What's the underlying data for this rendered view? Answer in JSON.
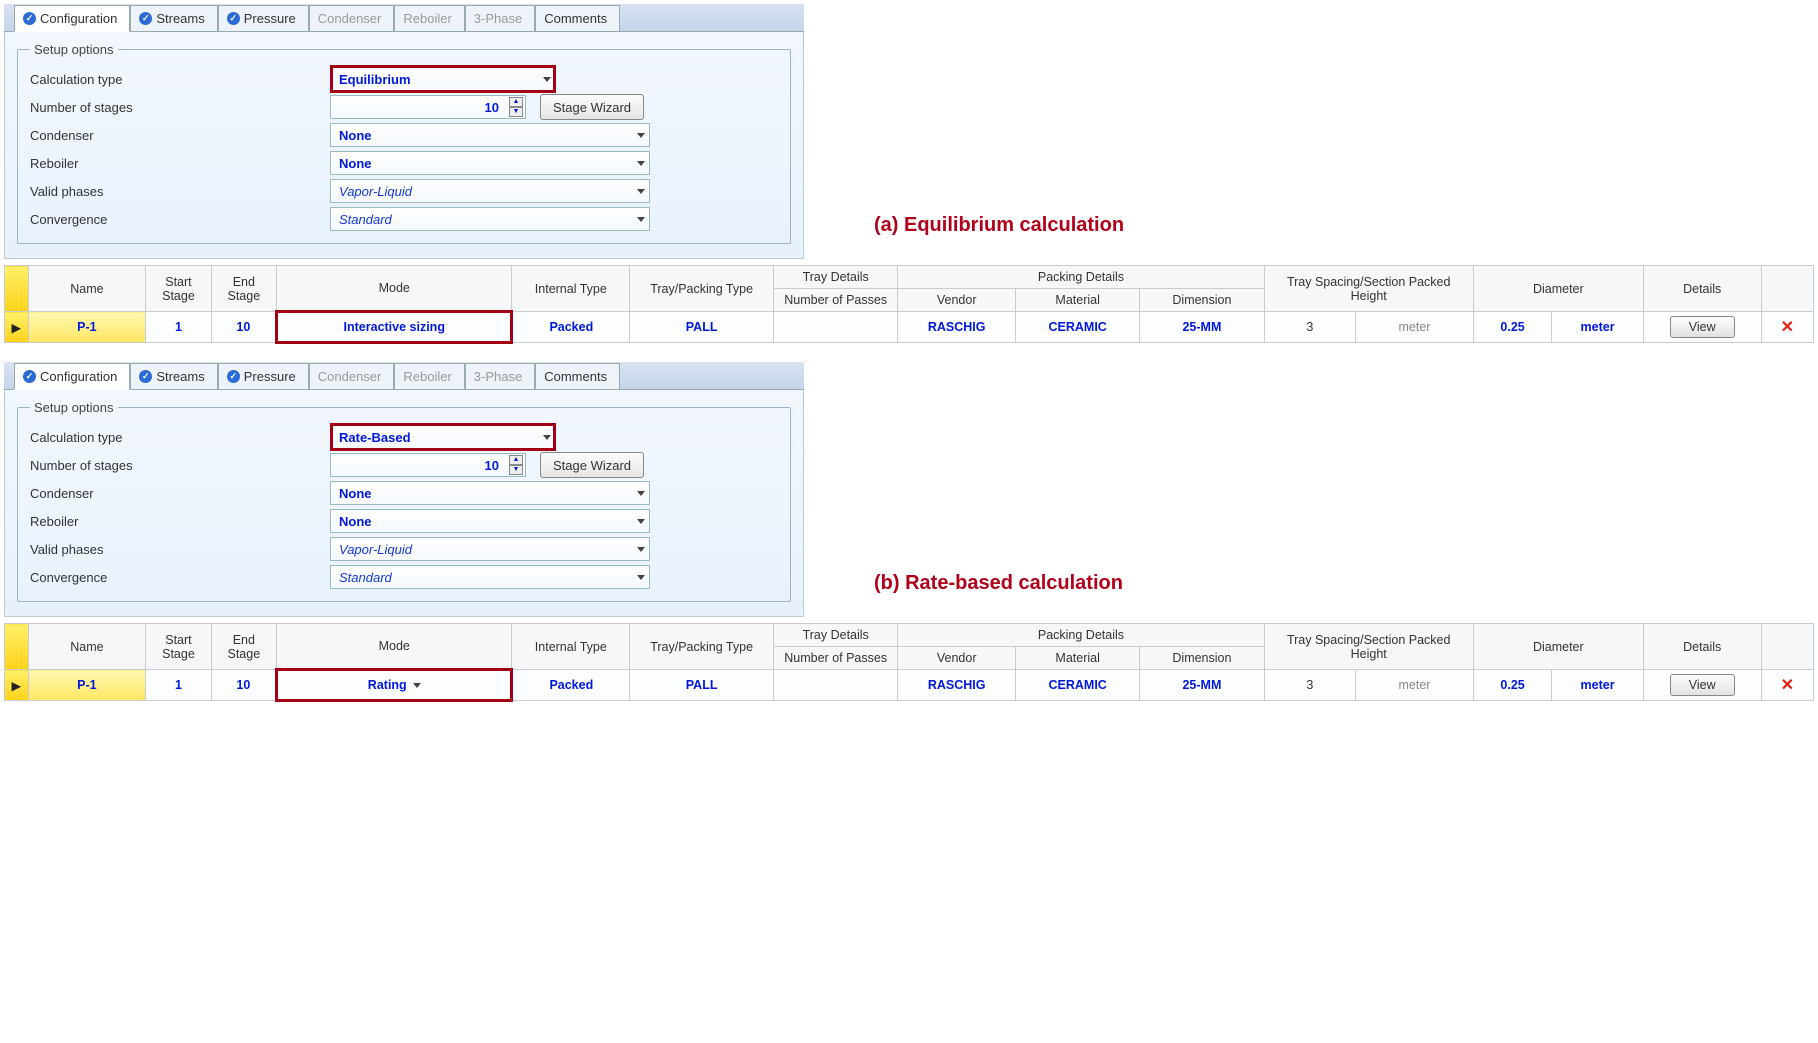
{
  "tabs": [
    {
      "label": "Configuration",
      "check": true,
      "active": true
    },
    {
      "label": "Streams",
      "check": true
    },
    {
      "label": "Pressure",
      "check": true
    },
    {
      "label": "Condenser",
      "disabled": true
    },
    {
      "label": "Reboiler",
      "disabled": true
    },
    {
      "label": "3-Phase",
      "disabled": true
    },
    {
      "label": "Comments"
    }
  ],
  "group_legend": "Setup options",
  "rows": {
    "calc_type": {
      "label": "Calculation type"
    },
    "num_stages": {
      "label": "Number of stages",
      "value": "10"
    },
    "condenser": {
      "label": "Condenser",
      "value": "None"
    },
    "reboiler": {
      "label": "Reboiler",
      "value": "None"
    },
    "valid_phases": {
      "label": "Valid phases",
      "value": "Vapor-Liquid"
    },
    "convergence": {
      "label": "Convergence",
      "value": "Standard"
    }
  },
  "stage_wizard": "Stage Wizard",
  "headers": {
    "name": "Name",
    "start": "Start Stage",
    "end": "End Stage",
    "mode": "Mode",
    "itype": "Internal Type",
    "tptype": "Tray/Packing Type",
    "tdetails": "Tray Details",
    "packing": "Packing Details",
    "spacing": "Tray Spacing/Section Packed Height",
    "diameter": "Diameter",
    "details": "Details",
    "passes": "Number of Passes",
    "vendor": "Vendor",
    "material": "Material",
    "dimension": "Dimension"
  },
  "row_common": {
    "name": "P-1",
    "start": "1",
    "end": "10",
    "itype": "Packed",
    "tptype": "PALL",
    "vendor": "RASCHIG",
    "material": "CERAMIC",
    "dimension": "25-MM",
    "spacing": "3",
    "spacing_unit": "meter",
    "diameter": "0.25",
    "diameter_unit": "meter",
    "view": "View"
  },
  "sectionA": {
    "calc_type": "Equilibrium",
    "mode": "Interactive sizing",
    "annot": "(a) Equilibrium calculation"
  },
  "sectionB": {
    "calc_type": "Rate-Based",
    "mode": "Rating",
    "annot": "(b) Rate-based calculation"
  }
}
